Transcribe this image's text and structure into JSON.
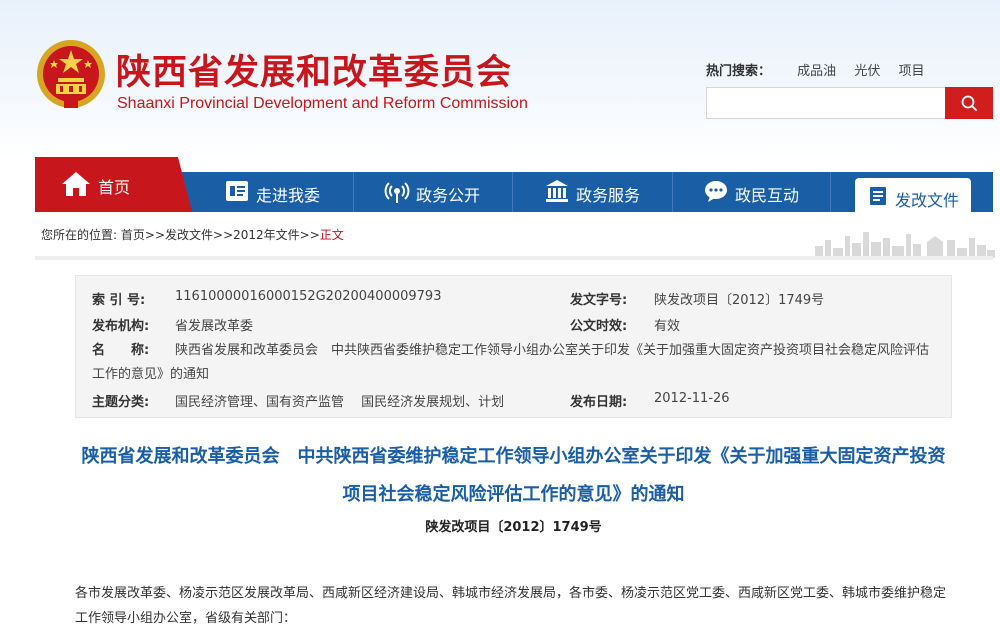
{
  "header": {
    "title": "陕西省发展和改革委员会",
    "subtitle": "Shaanxi Provincial Development and Reform Commission",
    "hot_search_label": "热门搜索：",
    "hot_search_items": [
      "成品油",
      "光伏",
      "项目"
    ],
    "search_placeholder": "",
    "search_icon": "search-icon",
    "brand_color": "#c8161d"
  },
  "nav": {
    "color": "#1a5ea6",
    "home": {
      "label": "首页",
      "icon": "home-icon"
    },
    "items": [
      {
        "label": "走进我委",
        "icon": "id-card-icon"
      },
      {
        "label": "政务公开",
        "icon": "broadcast-icon"
      },
      {
        "label": "政务服务",
        "icon": "building-icon"
      },
      {
        "label": "政民互动",
        "icon": "chat-icon"
      }
    ],
    "active": {
      "label": "发改文件",
      "icon": "document-icon"
    }
  },
  "breadcrumb": {
    "prefix": "您所在的位置:",
    "items": [
      "首页",
      "发改文件",
      "2012年文件"
    ],
    "separator": ">>",
    "current": "正文"
  },
  "meta": {
    "index_label": "索 引 号:",
    "index_value": "11610000016000152G20200400009793",
    "docno_label": "发文字号:",
    "docno_value": "陕发改项目〔2012〕1749号",
    "org_label": "发布机构:",
    "org_value": "省发展改革委",
    "validity_label": "公文时效:",
    "validity_value": "有效",
    "name_label": "名　　称:",
    "name_value": "陕西省发展和改革委员会　中共陕西省委维护稳定工作领导小组办公室关于印发《关于加强重大固定资产投资项目社会稳定风险评估工作的意见》的通知",
    "topic_label": "主题分类:",
    "topic_value": "国民经济管理、国有资产监管　 国民经济发展规划、计划",
    "date_label": "发布日期:",
    "date_value": "2012-11-26"
  },
  "article": {
    "title": "陕西省发展和改革委员会　中共陕西省委维护稳定工作领导小组办公室关于印发《关于加强重大固定资产投资项目社会稳定风险评估工作的意见》的通知",
    "doc_number": "陕发改项目〔2012〕1749号",
    "body_first_para": "各市发展改革委、杨凌示范区发展改革局、西咸新区经济建设局、韩城市经济发展局，各市委、杨凌示范区党工委、西咸新区党工委、韩城市委维护稳定工作领导小组办公室，省级有关部门："
  }
}
